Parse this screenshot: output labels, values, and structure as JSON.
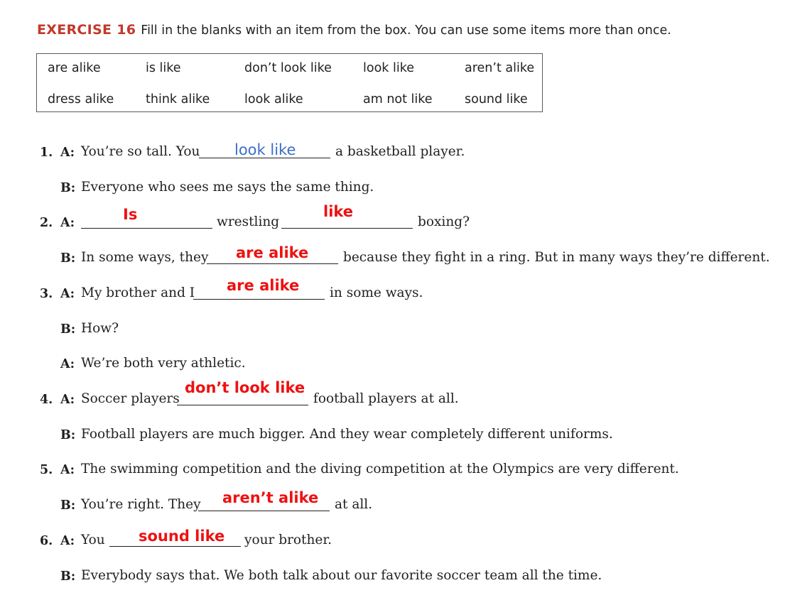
{
  "exercise": {
    "label": "EXERCISE 16",
    "instructions": "Fill in the blanks with an item from the box. You can use some items more than once."
  },
  "word_box": [
    "are alike",
    "is like",
    "don’t look like",
    "look like",
    "aren’t alike",
    "dress alike",
    "think alike",
    "look alike",
    "am not like",
    "sound like"
  ],
  "speakers": {
    "a": "A:",
    "b": "B:"
  },
  "items": {
    "n1": "1.",
    "n2": "2.",
    "n3": "3.",
    "n4": "4.",
    "n5": "5.",
    "n6": "6.",
    "i1_a_pre": "You’re so tall. You",
    "i1_a_ans": "look like",
    "i1_a_post": "a basketball player.",
    "i1_b": "Everyone who sees me says the same thing.",
    "i2_a_ans1": "Is",
    "i2_a_mid": "wrestling",
    "i2_a_ans2": "like",
    "i2_a_post": "boxing?",
    "i2_b_pre": "In some ways, they",
    "i2_b_ans": "are alike",
    "i2_b_post": "because they fight in a ring. But in many ways they’re different.",
    "i3_a_pre": "My brother and I",
    "i3_a_ans": "are alike",
    "i3_a_post": "in some ways.",
    "i3_b": "How?",
    "i3_a2": "We’re both very athletic.",
    "i4_a_pre": "Soccer players",
    "i4_a_ans": "don’t look like",
    "i4_a_post": "football players at all.",
    "i4_b": "Football players are much bigger. And they wear completely different uniforms.",
    "i5_a": "The swimming competition and the diving competition at the Olympics are very different.",
    "i5_b_pre": "You’re right. They",
    "i5_b_ans": "aren’t alike",
    "i5_b_post": "at all.",
    "i6_a_pre": "You",
    "i6_a_ans": "sound like",
    "i6_a_post": "your brother.",
    "i6_b": "Everybody says that. We both talk about our favorite soccer team all the time."
  }
}
